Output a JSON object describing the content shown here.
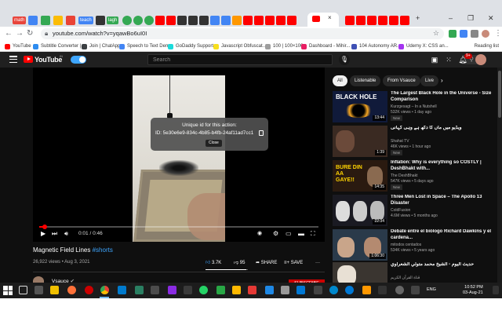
{
  "browser": {
    "pinned_tabs": [
      {
        "label": "math",
        "color": "#e8453c"
      },
      {
        "label": "teach",
        "color": "#4285f4"
      },
      {
        "label": "lagh",
        "color": "#34a853"
      }
    ],
    "address": {
      "url": "youtube.com/watch?v=yqawBo6uI0I"
    },
    "bookmarks": [
      {
        "label": "YouTube",
        "color": "#ff0000"
      },
      {
        "label": "Subtitle Converter |...",
        "color": "#2d8cf0"
      },
      {
        "label": "Join | ChatApp",
        "color": "#3c4043"
      },
      {
        "label": "Speech to Text Demo",
        "color": "#4285f4"
      },
      {
        "label": "GoDaddy Support",
        "color": "#1bdbdb"
      },
      {
        "label": "Javascript Obfuscat...",
        "color": "#f7df1e"
      },
      {
        "label": "100 | 100×100",
        "color": "#9e9e9e"
      },
      {
        "label": "Dashboard - Mihir...",
        "color": "#e91e63"
      },
      {
        "label": "104 Autonomy AR...",
        "color": "#3f51b5"
      },
      {
        "label": "Udemy X: CSS an...",
        "color": "#a435f0"
      }
    ],
    "bookmarks_right": "Reading list"
  },
  "youtube": {
    "logo_text": "YouTube",
    "logo_sup": "IN",
    "search_placeholder": "Search",
    "notification_count": "9+"
  },
  "player": {
    "dialog": {
      "title": "Unique id for this action:",
      "id_text": "ID: 5e30e6e9-834c-4b85-b4fb-24af11ad7cc1",
      "close_label": "Close"
    },
    "time": "0:01 / 0:46",
    "progress": 0.02
  },
  "video": {
    "title": "Magnetic Field Lines",
    "hashtag": "#shorts",
    "meta": "26,922 views • Aug 3, 2021",
    "likes": "3.7K",
    "dislikes": "95",
    "share_label": "SHARE",
    "save_label": "SAVE",
    "like_ratio": 0.97,
    "channel": "Vsauce",
    "subscribe_label": "SUBSCRIBE"
  },
  "sidebar": {
    "chips": [
      "All",
      "Listenable",
      "From Vsauce",
      "Live"
    ],
    "recommendations": [
      {
        "title": "The Largest Black Hole in the Universe - Size Comparison",
        "channel": "Kurzgesagt – In a Nutshell",
        "views": "532K views • 1 day ago",
        "badge": "New",
        "duration": "13:44",
        "thumb_text": "BLACK HOLE",
        "thumb_bg": "#101a3a"
      },
      {
        "title": "ویڈیو میں ماں کا دکھ ہے وہی کہانی",
        "channel": "Shahat TV",
        "views": "46K views • 1 hour ago",
        "badge": "New",
        "duration": "1:39",
        "thumb_text": "",
        "thumb_bg": "#3a2a22"
      },
      {
        "title": "Inflation: Why is everything so COSTLY | DeshBhakt with...",
        "channel": "The DeshBhakt",
        "views": "547K views • 5 days ago",
        "badge": "New",
        "duration": "14:35",
        "thumb_text": "BURE DIN AA GAYE!!",
        "thumb_bg": "#2a1a10"
      },
      {
        "title": "Three Men Lost in Space – The Apollo 13 Disaster",
        "channel": "ColdFusion",
        "views": "4.6M views • 5 months ago",
        "badge": "",
        "duration": "22:34",
        "thumb_text": "",
        "thumb_bg": "#1a1a22"
      },
      {
        "title": "Debate entre el biólogo Richard Dawkins y el cardena...",
        "channel": "mitodos centados",
        "views": "534K views • 5 years ago",
        "badge": "",
        "duration": "1:06:30",
        "thumb_text": "",
        "thumb_bg": "#2a3a4a"
      },
      {
        "title": "حديث اليوم - الشيخ محمد متولي الشعراوي",
        "channel": "قناة القرآن الكريم",
        "views": "",
        "badge": "",
        "duration": "",
        "thumb_text": "",
        "thumb_bg": "#3a3530"
      }
    ]
  },
  "taskbar": {
    "time": "10:52 PM",
    "date": "03-Aug-21",
    "lang": "ENG"
  }
}
